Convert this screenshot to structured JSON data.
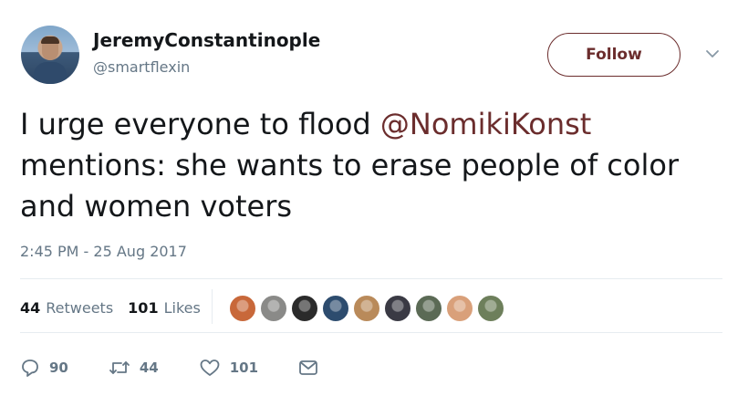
{
  "user": {
    "display_name": "JeremyConstantinople",
    "handle": "@smartflexin"
  },
  "follow_button": {
    "label": "Follow"
  },
  "tweet": {
    "text_before": "I urge everyone to flood ",
    "mention": "@NomikiKonst",
    "text_after": " mentions: she wants to erase people of color and women voters",
    "timestamp": "2:45 PM - 25 Aug 2017"
  },
  "stats": {
    "retweets_count": "44",
    "retweets_label": "Retweets",
    "likes_count": "101",
    "likes_label": "Likes"
  },
  "actions": {
    "reply_count": "90",
    "retweet_count": "44",
    "like_count": "101"
  },
  "colors": {
    "accent": "#6b2d2d",
    "muted": "#657786",
    "text": "#14171a",
    "divider": "#e6ecf0"
  },
  "icons": [
    "reply-icon",
    "retweet-icon",
    "heart-icon",
    "message-icon",
    "chevron-down-icon"
  ],
  "liker_avatars": [
    {
      "color": "#c8683a"
    },
    {
      "color": "#8a8a88"
    },
    {
      "color": "#2b2b2b"
    },
    {
      "color": "#2d4c6e"
    },
    {
      "color": "#b98a5a"
    },
    {
      "color": "#3a3a44"
    },
    {
      "color": "#5b6a55"
    },
    {
      "color": "#d9a07a"
    },
    {
      "color": "#6d7f5b"
    }
  ]
}
